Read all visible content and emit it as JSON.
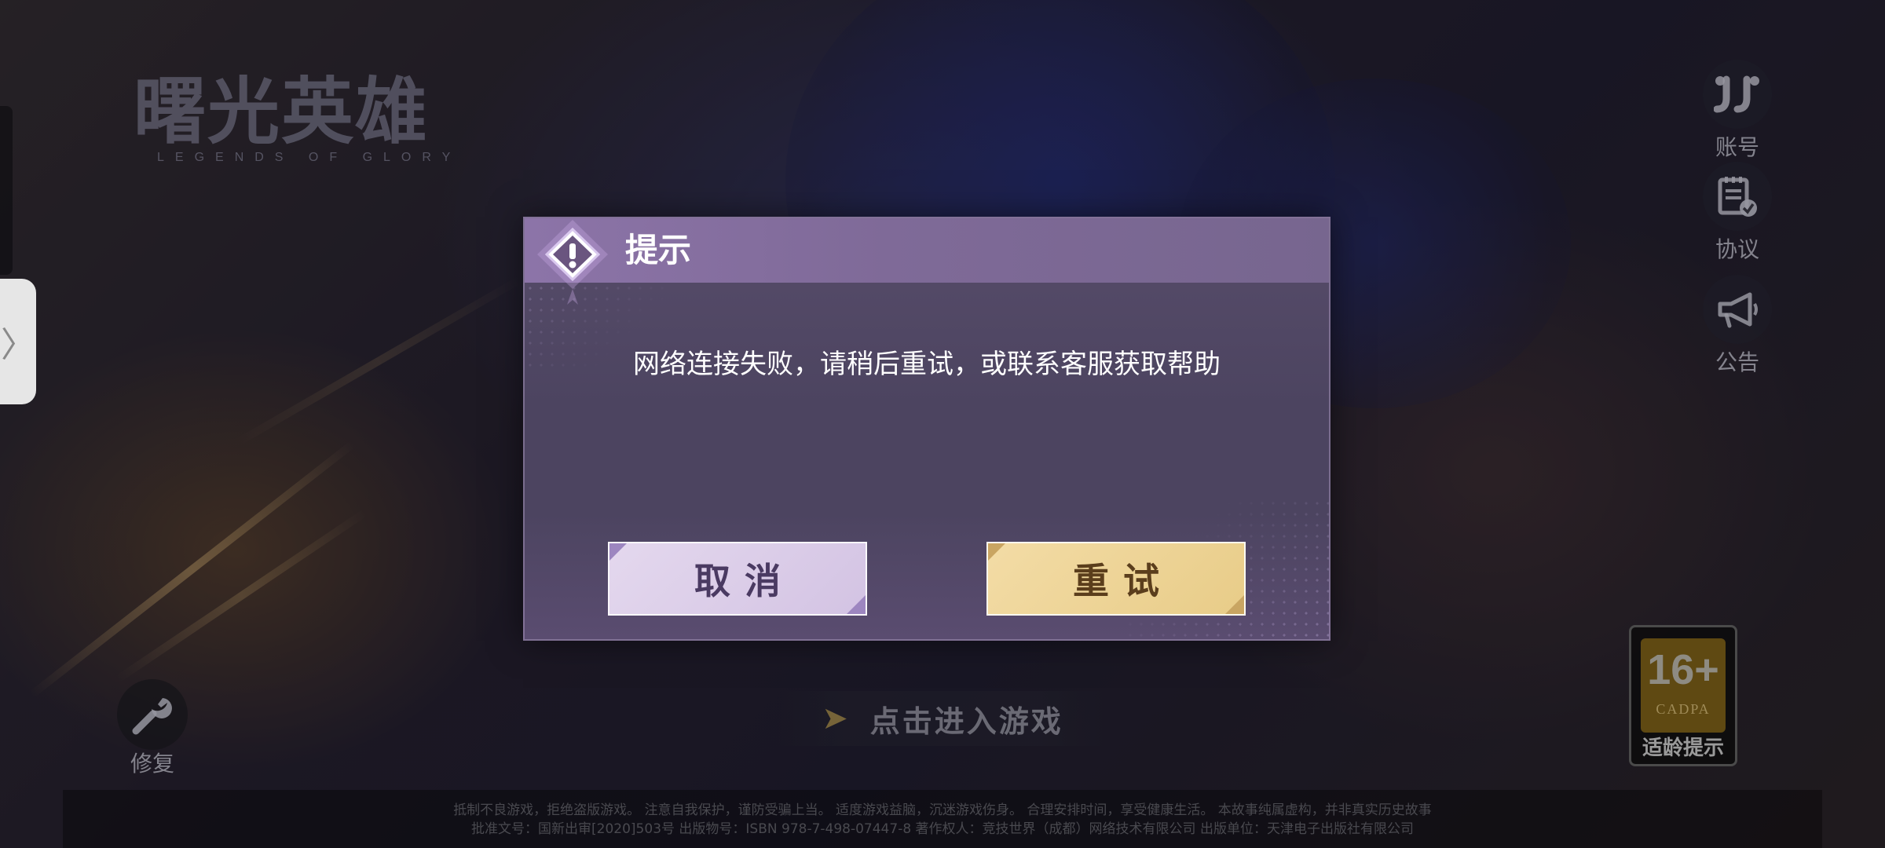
{
  "game": {
    "logo_title": "曙光英雄",
    "logo_subtitle": "LEGENDS OF GLORY"
  },
  "side_menu": {
    "handle_glyph": "〉",
    "account": {
      "label": "账号",
      "icon": "account-logo-icon"
    },
    "agreement": {
      "label": "协议",
      "icon": "document-check-icon"
    },
    "notice": {
      "label": "公告",
      "icon": "megaphone-icon"
    }
  },
  "repair": {
    "label": "修复",
    "icon": "wrench-icon"
  },
  "enter_game": {
    "label": "点击进入游戏",
    "icon": "arrow-right-icon"
  },
  "age_rating": {
    "age": "16+",
    "org": "CADPA",
    "label": "适龄提示"
  },
  "footer": {
    "line1": "抵制不良游戏，拒绝盗版游戏。 注意自我保护，谨防受骗上当。 适度游戏益脑，沉迷游戏伤身。 合理安排时间，享受健康生活。 本故事纯属虚构，并非真实历史故事",
    "line2": "批准文号：国新出审[2020]503号 出版物号：ISBN 978-7-498-07447-8 著作权人：竞技世界（成都）网络技术有限公司 出版单位：天津电子出版社有限公司"
  },
  "dialog": {
    "title": "提示",
    "icon": "exclamation-icon",
    "message": "网络连接失败，请稍后重试，或联系客服获取帮助",
    "cancel_label": "取消",
    "retry_label": "重试",
    "colors": {
      "header": "#8c74a8",
      "body": "#4c4460",
      "cancel_bg": "#dccfe9",
      "retry_bg": "#efd598"
    }
  }
}
